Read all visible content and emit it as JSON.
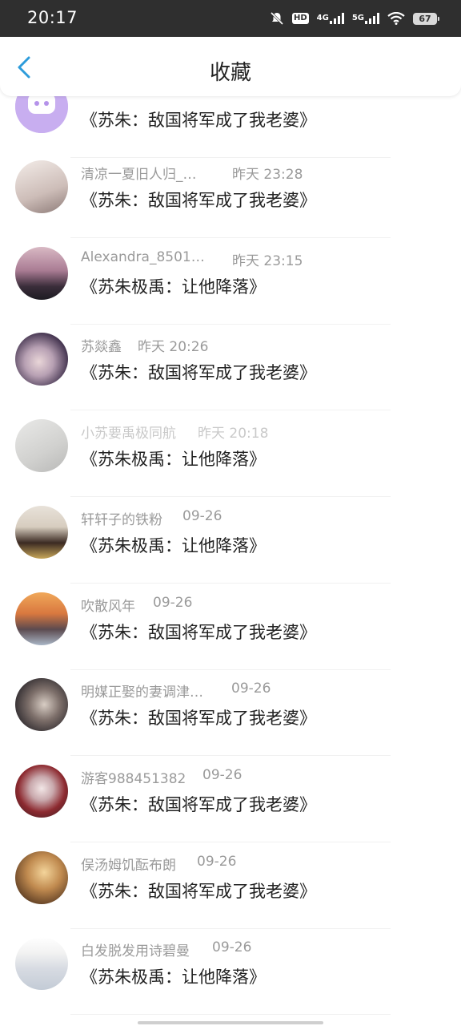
{
  "status_bar": {
    "time": "20:17",
    "battery": "67",
    "net1": "4G",
    "net2": "5G",
    "hd": "HD"
  },
  "header": {
    "title": "收藏"
  },
  "items": [
    {
      "name": "",
      "time": "",
      "book": "《苏朱：敌国将军成了我老婆》"
    },
    {
      "name": "清凉一夏旧人归_…",
      "time": "昨天  23:28",
      "book": "《苏朱：敌国将军成了我老婆》"
    },
    {
      "name": "Alexandra_8501…",
      "time": "昨天  23:15",
      "book": "《苏朱极禹：让他降落》"
    },
    {
      "name": "苏燚鑫",
      "time": "昨天  20:26",
      "book": "《苏朱：敌国将军成了我老婆》"
    },
    {
      "name": "小苏要禹极同航",
      "time": "昨天  20:18",
      "book": "《苏朱极禹：让他降落》"
    },
    {
      "name": "轩轩子的铁粉",
      "time": "09-26",
      "book": "《苏朱极禹：让他降落》"
    },
    {
      "name": "吹散风年",
      "time": "09-26",
      "book": "《苏朱：敌国将军成了我老婆》"
    },
    {
      "name": "明媒正娶的妻调津…",
      "time": "09-26",
      "book": "《苏朱：敌国将军成了我老婆》"
    },
    {
      "name": "游客988451382",
      "time": "09-26",
      "book": "《苏朱：敌国将军成了我老婆》"
    },
    {
      "name": "俣汤姆饥酝布朗",
      "time": "09-26",
      "book": "《苏朱：敌国将军成了我老婆》"
    },
    {
      "name": "白发脱发用诗碧曼",
      "time": "09-26",
      "book": "《苏朱极禹：让他降落》"
    }
  ],
  "colors": {
    "accent": "#2d9cdb",
    "title": "#222222",
    "meta": "#9a9a9a"
  }
}
